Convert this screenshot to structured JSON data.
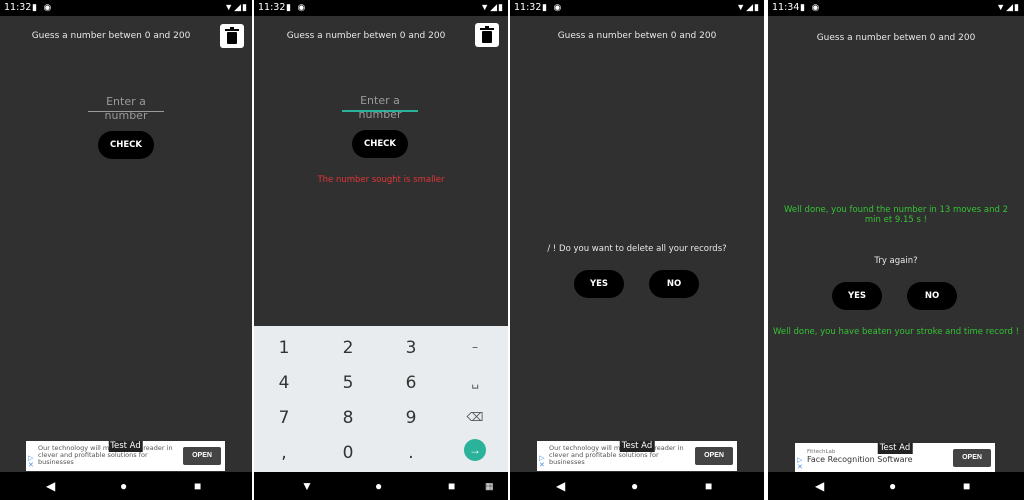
{
  "screens": [
    {
      "time": "11:32",
      "title": "Guess a number betwen 0 and 200",
      "input_placeholder": "Enter a number",
      "check_label": "CHECK",
      "ad": {
        "tag": "Test Ad",
        "text": "Our technology will make every reader in clever and profitable solutions for businesses",
        "open": "OPEN"
      }
    },
    {
      "time": "11:32",
      "title": "Guess a number betwen 0 and 200",
      "input_placeholder": "Enter a number",
      "check_label": "CHECK",
      "message": "The number sought is smaller",
      "keys": [
        "1",
        "2",
        "3",
        "–",
        "4",
        "5",
        "6",
        "␣",
        "7",
        "8",
        "9",
        "⌫",
        ",",
        "0",
        "."
      ]
    },
    {
      "time": "11:32",
      "title": "Guess a number betwen 0 and 200",
      "question": "/ ! Do you want to delete all your records?",
      "yes_label": "YES",
      "no_label": "NO",
      "ad": {
        "tag": "Test Ad",
        "text": "Our technology will make every reader in clever and profitable solutions for businesses",
        "open": "OPEN"
      }
    },
    {
      "time": "11:34",
      "title": "Guess a number betwen 0 and 200",
      "success": "Well done, you found the number in 13 moves and 2 min et 9.15 s !",
      "try_again": "Try again?",
      "yes_label": "YES",
      "no_label": "NO",
      "record": "Well done, you have beaten your stroke and time record !",
      "ad": {
        "tag": "Test Ad",
        "small": "FittechLab",
        "text": "Face Recognition Software",
        "open": "OPEN"
      }
    }
  ],
  "colors": {
    "background": "#303030",
    "error": "#e23535",
    "success": "#35c235",
    "accent": "#2ab29a"
  }
}
